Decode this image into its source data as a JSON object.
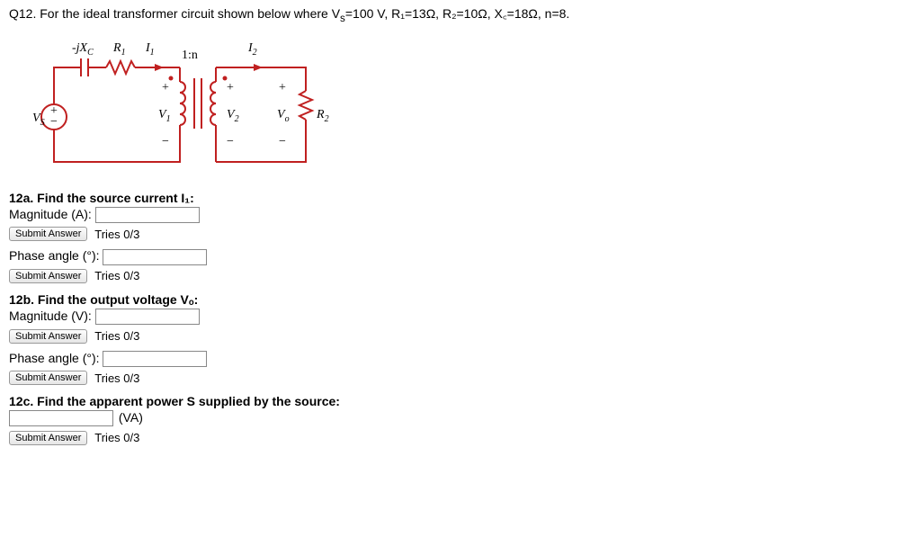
{
  "question": {
    "header": "Q12. For the ideal transformer circuit shown below where V",
    "params_text": "=100 V, R₁=13Ω, R₂=10Ω, X꜀=18Ω, n=8.",
    "sub_s": "s"
  },
  "circuit": {
    "cap_label": "-jX",
    "cap_sub": "C",
    "R1": "R",
    "R1_sub": "1",
    "I1": "I",
    "I1_sub": "1",
    "ratio": "1:n",
    "I2": "I",
    "I2_sub": "2",
    "Vs": "V",
    "Vs_sub": "S",
    "V1": "V",
    "V1_sub": "1",
    "V2": "V",
    "V2_sub": "2",
    "Vo": "V",
    "Vo_sub": "o",
    "R2": "R",
    "R2_sub": "2",
    "plus": "+",
    "minus": "−"
  },
  "parts": {
    "a_title": "12a. Find the source current I₁:",
    "a_mag": "Magnitude (A):",
    "a_phase": "Phase angle (°):",
    "b_title": "12b. Find the output voltage Vₒ:",
    "b_mag": "Magnitude (V):",
    "b_phase": "Phase angle (°):",
    "c_title": "12c. Find the apparent power S supplied by the source:",
    "c_unit": "(VA)"
  },
  "buttons": {
    "submit": "Submit Answer"
  },
  "tries": "Tries 0/3"
}
